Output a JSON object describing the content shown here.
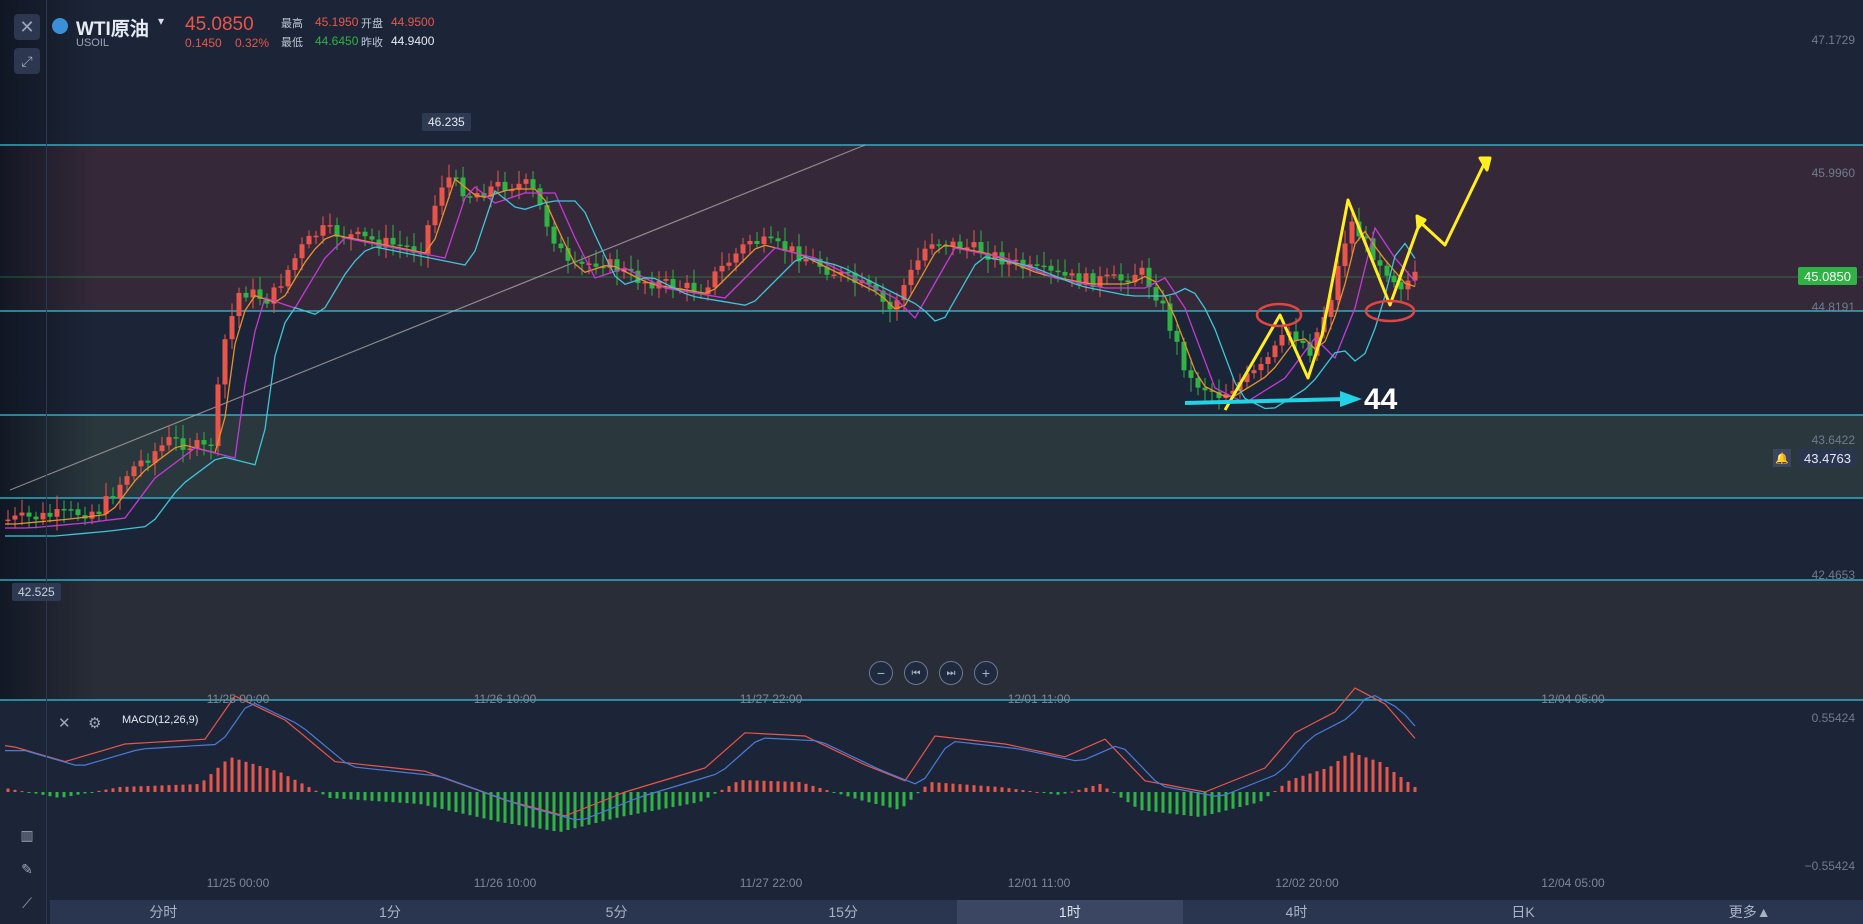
{
  "header": {
    "symbol_name": "WTI原油",
    "symbol_code": "USOIL",
    "last_price": "45.0850",
    "change": "0.1450",
    "change_pct": "0.32%",
    "high_label": "最高",
    "high_value": "45.1950",
    "open_label": "开盘",
    "open_value": "44.9500",
    "low_label": "最低",
    "low_value": "44.6450",
    "prev_close_label": "昨收",
    "prev_close_value": "44.9400"
  },
  "price_axis": {
    "labels": [
      "47.1729",
      "45.9960",
      "44.8191",
      "43.6422",
      "42.4653"
    ],
    "current_price": "45.0850",
    "alert_price": "43.4763"
  },
  "chart": {
    "peak_label": "46.235",
    "low_label": "42.525",
    "annotation_text": "44"
  },
  "time_axis": {
    "labels": [
      "11/25 00:00",
      "11/26 10:00",
      "11/27 22:00",
      "12/01 11:00",
      "12/02 20:00",
      "12/04 05:00"
    ]
  },
  "macd": {
    "title": "MACD(12,26,9)",
    "upper": "0.55424",
    "lower": "−0.55424"
  },
  "periods": {
    "items": [
      "分时",
      "1分",
      "5分",
      "15分",
      "1时",
      "4时",
      "日K",
      "更多▲"
    ],
    "active": "1时"
  },
  "colors": {
    "up": "#e8564b",
    "down": "#2fb344",
    "ma_orange": "#e8912e",
    "ma_purple": "#c43bd4",
    "ma_cyan": "#3ec5d6",
    "annotation_yellow": "#ffee22",
    "current_price_bg": "#2fb344"
  },
  "icons": {
    "close": "close-icon",
    "draw": "draw-tool-icon",
    "settings": "gear-icon",
    "bell": "bell-icon",
    "zoom_out": "minus-icon",
    "prev": "step-back-icon",
    "next": "step-forward-icon",
    "zoom_in": "plus-icon"
  }
}
